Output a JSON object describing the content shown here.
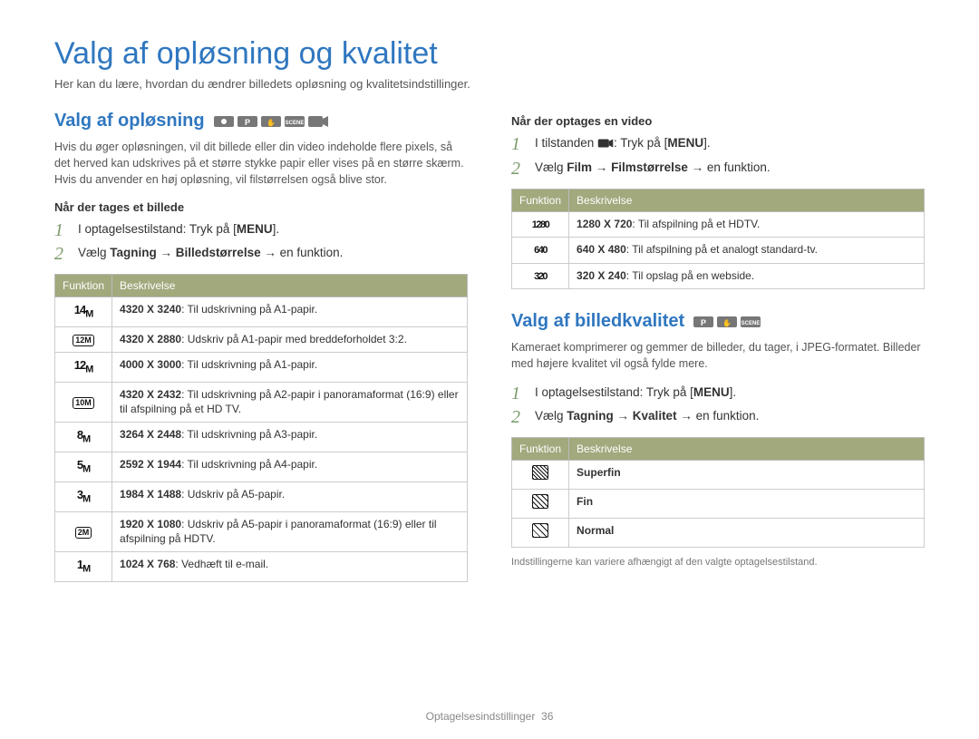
{
  "title": "Valg af opløsning og kvalitet",
  "intro": "Her kan du lære, hvordan du ændrer billedets opløsning og kvalitetsindstillinger.",
  "section1": {
    "heading": "Valg af opløsning",
    "blurb": "Hvis du øger opløsningen, vil dit billede eller din video indeholde flere pixels, så det herved kan udskrives på et større stykke papir eller vises på en større skærm. Hvis du anvender en høj opløsning, vil filstørrelsen også blive stor.",
    "photo_sub": "Når der tages et billede",
    "photo_steps": [
      "I optagelsestilstand: Tryk på [",
      "Vælg "
    ],
    "photo_step1_menu": "MENU",
    "photo_step1_end": "].",
    "photo_step2_b1": "Tagning",
    "photo_step2_arrow1": " → ",
    "photo_step2_b2": "Billedstørrelse",
    "photo_step2_arrow2": " → en funktion.",
    "photo_table_head_func": "Funktion",
    "photo_table_head_desc": "Beskrivelse",
    "photo_rows": [
      {
        "glyph": "14M",
        "res": "4320 X 3240",
        "desc": ": Til udskrivning på A1-papir."
      },
      {
        "glyph": "12Mw",
        "res": "4320 X 2880",
        "desc": ": Udskriv på A1-papir med breddeforholdet 3:2."
      },
      {
        "glyph": "12M",
        "res": "4000 X 3000",
        "desc": ": Til udskrivning på A1-papir."
      },
      {
        "glyph": "10Mw",
        "res": "4320 X 2432",
        "desc": ": Til udskrivning på A2-papir i panoramaformat (16:9) eller til afspilning på et HD TV."
      },
      {
        "glyph": "8M",
        "res": "3264 X 2448",
        "desc": ": Til udskrivning på A3-papir."
      },
      {
        "glyph": "5M",
        "res": "2592 X 1944",
        "desc": ": Til udskrivning på A4-papir."
      },
      {
        "glyph": "3M",
        "res": "1984 X 1488",
        "desc": ": Udskriv på A5-papir."
      },
      {
        "glyph": "2Mw",
        "res": "1920 X 1080",
        "desc": ": Udskriv på A5-papir i panoramaformat (16:9) eller til afspilning på HDTV."
      },
      {
        "glyph": "1M",
        "res": "1024 X 768",
        "desc": ": Vedhæft til e-mail."
      }
    ]
  },
  "video": {
    "sub": "Når der optages en video",
    "step1_pre": "I tilstanden ",
    "step1_mid": ": Tryk på [",
    "step1_menu": "MENU",
    "step1_end": "].",
    "step2_pre": "Vælg ",
    "step2_b1": "Film",
    "step2_arrow1": " → ",
    "step2_b2": "Filmstørrelse",
    "step2_arrow2": " → en funktion.",
    "table_head_func": "Funktion",
    "table_head_desc": "Beskrivelse",
    "rows": [
      {
        "glyph": "1280",
        "res": "1280 X 720",
        "desc": ": Til afspilning på et HDTV."
      },
      {
        "glyph": "640",
        "res": "640 X 480",
        "desc": ": Til afspilning på et analogt standard-tv."
      },
      {
        "glyph": "320",
        "res": "320 X 240",
        "desc": ": Til opslag på en webside."
      }
    ]
  },
  "quality": {
    "heading": "Valg af billedkvalitet",
    "blurb": "Kameraet komprimerer og gemmer de billeder, du tager, i JPEG-formatet. Billeder med højere kvalitet vil også fylde mere.",
    "step1_pre": "I optagelsestilstand: Tryk på [",
    "step1_menu": "MENU",
    "step1_end": "].",
    "step2_pre": "Vælg ",
    "step2_b1": "Tagning",
    "step2_arrow1": " → ",
    "step2_b2": "Kvalitet",
    "step2_arrow2": " → en funktion.",
    "table_head_func": "Funktion",
    "table_head_desc": "Beskrivelse",
    "rows": [
      {
        "label": "Superfin"
      },
      {
        "label": "Fin"
      },
      {
        "label": "Normal"
      }
    ],
    "note": "Indstillingerne kan variere afhængigt af den valgte optagelsestilstand."
  },
  "footer": {
    "section": "Optagelsesindstillinger",
    "page": "36"
  }
}
